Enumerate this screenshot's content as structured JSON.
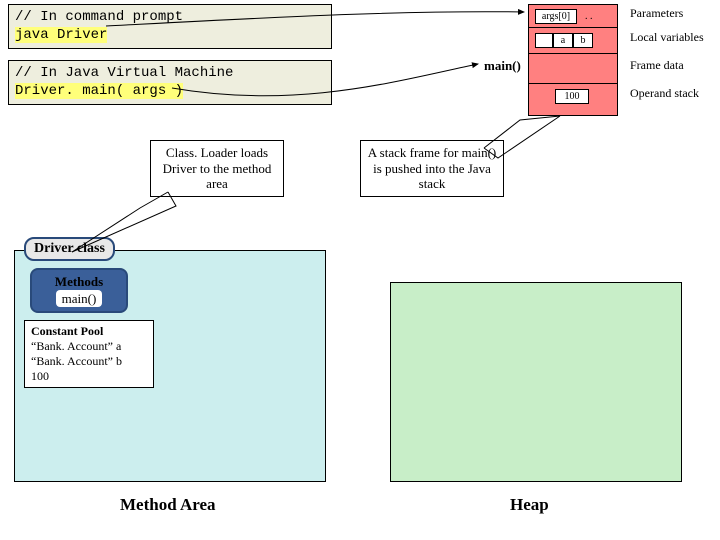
{
  "code1": {
    "comment": "// In command prompt",
    "cmd": "java Driver"
  },
  "code2": {
    "comment": "// In Java Virtual Machine",
    "call": "Driver. main( args )"
  },
  "stack": {
    "param": "args[0]",
    "param_dots": ". .",
    "locals": [
      "",
      "a",
      "b"
    ],
    "frame_label": "main()",
    "operand": "100",
    "tags": {
      "parameters": "Parameters",
      "locals": "Local variables",
      "frame": "Frame data",
      "operand": "Operand stack"
    }
  },
  "callout1": "Class. Loader loads Driver to the method area",
  "callout2": "A stack frame for main() is pushed into the Java stack",
  "driver_class": "Driver class",
  "methods": {
    "title": "Methods",
    "item": "main()"
  },
  "constant_pool": {
    "title": "Constant Pool",
    "l1": "“Bank. Account” a",
    "l2": "“Bank. Account” b",
    "l3": "100"
  },
  "method_area_label": "Method Area",
  "heap_label": "Heap"
}
